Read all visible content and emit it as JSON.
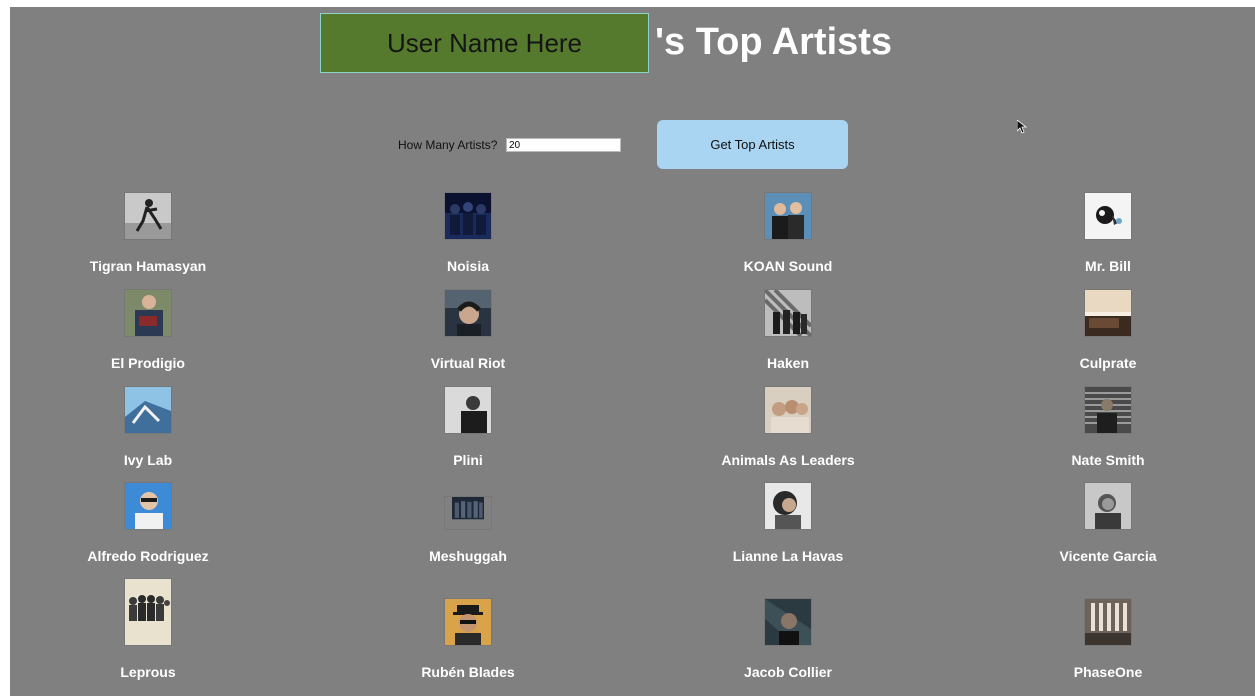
{
  "header": {
    "username_placeholder": "User Name Here",
    "title_suffix": "'s Top Artists"
  },
  "controls": {
    "count_label": "How Many Artists?",
    "count_value": "20",
    "button_label": "Get Top Artists"
  },
  "artists": [
    {
      "name": "Tigran Hamasyan"
    },
    {
      "name": "Noisia"
    },
    {
      "name": "KOAN Sound"
    },
    {
      "name": "Mr. Bill"
    },
    {
      "name": "El Prodigio"
    },
    {
      "name": "Virtual Riot"
    },
    {
      "name": "Haken"
    },
    {
      "name": "Culprate"
    },
    {
      "name": "Ivy Lab"
    },
    {
      "name": "Plini"
    },
    {
      "name": "Animals As Leaders"
    },
    {
      "name": "Nate Smith"
    },
    {
      "name": "Alfredo Rodriguez"
    },
    {
      "name": "Meshuggah"
    },
    {
      "name": "Lianne La Havas"
    },
    {
      "name": "Vicente Garcia"
    },
    {
      "name": "Leprous"
    },
    {
      "name": "Rubén Blades"
    },
    {
      "name": "Jacob Collier"
    },
    {
      "name": "PhaseOne"
    }
  ],
  "colors": {
    "background": "#808080",
    "username_field": "#557a2e",
    "button": "#a9d4f2"
  }
}
